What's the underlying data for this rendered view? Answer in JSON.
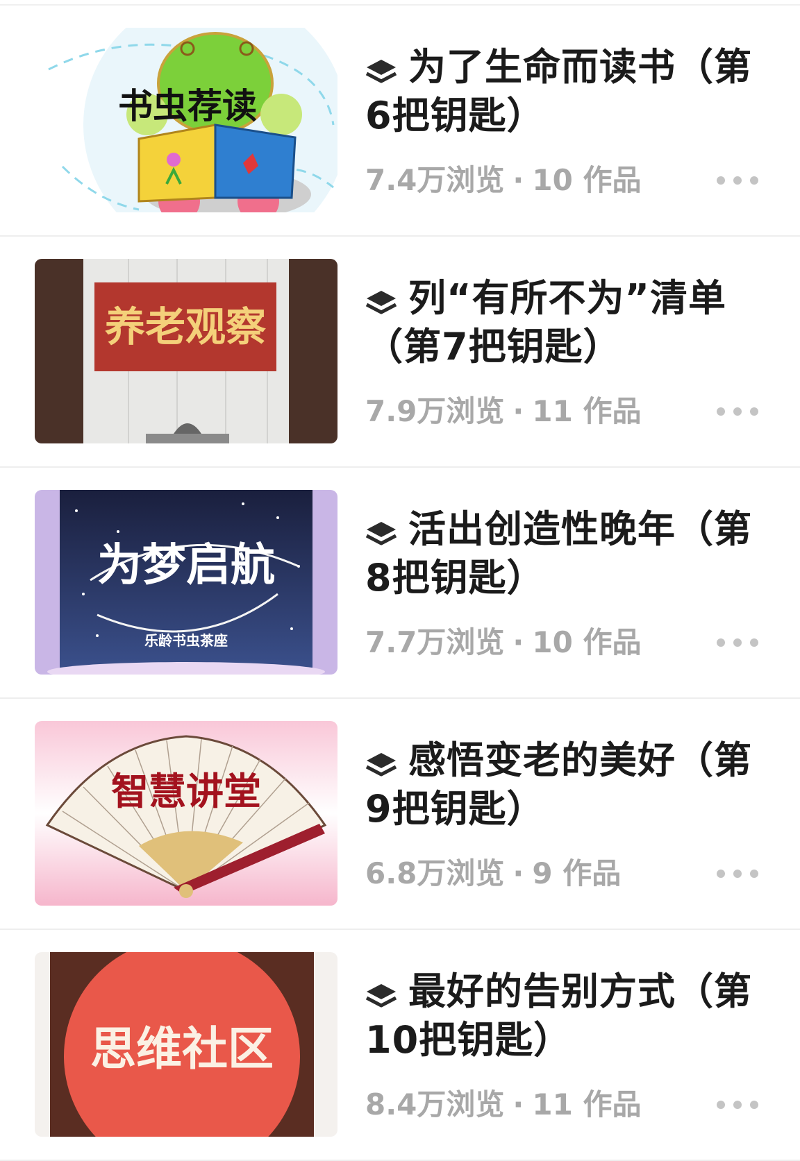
{
  "items": [
    {
      "title": "为了生命而读书（第6把钥匙）",
      "views": "7.4万浏览",
      "works": "10 作品",
      "thumb_text": "书虫荐读"
    },
    {
      "title": "列“有所不为”清单（第7把钥匙）",
      "views": "7.9万浏览",
      "works": "11 作品",
      "thumb_text": "养老观察"
    },
    {
      "title": "活出创造性晚年（第8把钥匙）",
      "views": "7.7万浏览",
      "works": "10 作品",
      "thumb_text": "为梦启航",
      "thumb_subtext": "乐龄书虫茶座"
    },
    {
      "title": "感悟变老的美好（第9把钥匙）",
      "views": "6.8万浏览",
      "works": "9 作品",
      "thumb_text": "智慧讲堂"
    },
    {
      "title": "最好的告别方式（第10把钥匙）",
      "views": "8.4万浏览",
      "works": "11 作品",
      "thumb_text": "思维社区"
    }
  ],
  "meta_separator": "·",
  "icons": {
    "collection": "layers-icon",
    "more": "more-horizontal-icon"
  },
  "colors": {
    "title": "#1b1b1b",
    "meta": "#a8a8a8",
    "divider": "#eeeeee"
  }
}
